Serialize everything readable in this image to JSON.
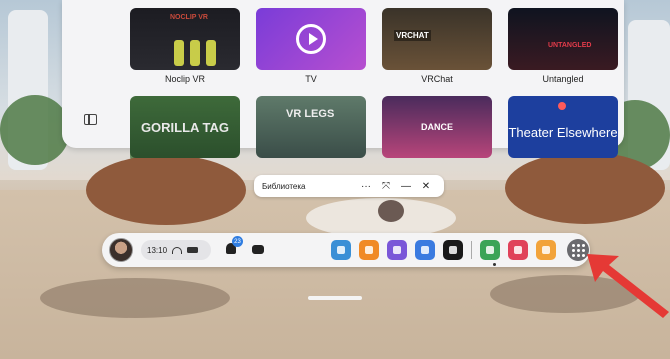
{
  "library": {
    "apps": [
      {
        "name": "Noclip VR",
        "thumb_text": "NOCLIP VR",
        "theme": "t-noclip"
      },
      {
        "name": "TV",
        "thumb_text": "",
        "theme": "t-tv"
      },
      {
        "name": "VRChat",
        "thumb_text": "VRCHAT",
        "theme": "t-vrchat"
      },
      {
        "name": "Untangled",
        "thumb_text": "UNTANGLED",
        "theme": "t-untangled"
      },
      {
        "name": "",
        "thumb_text": "GORILLA TAG",
        "theme": "t-gorilla"
      },
      {
        "name": "",
        "thumb_text": "VR LEGS",
        "theme": "t-vrlegs"
      },
      {
        "name": "",
        "thumb_text": "DANCE",
        "theme": "t-dance"
      },
      {
        "name": "",
        "thumb_text": "Theater Elsewhere",
        "theme": "t-theater"
      }
    ]
  },
  "titlebar": {
    "title": "Библиотека",
    "more_label": "···",
    "expand_label": "⤧",
    "minimize_label": "—",
    "close_label": "✕"
  },
  "dock": {
    "time": "13:10",
    "notification_count": "23",
    "app_icons": [
      {
        "name": "app-icon-photos",
        "color": "#3a8fd6"
      },
      {
        "name": "app-icon-store",
        "color": "#f08a26"
      },
      {
        "name": "app-icon-messenger",
        "color": "#7a57d8"
      },
      {
        "name": "app-icon-explore",
        "color": "#3b7be0"
      },
      {
        "name": "app-icon-theater-elsewhere",
        "color": "#1a1a1a"
      },
      {
        "name": "app-icon-files",
        "color": "#3aa457"
      },
      {
        "name": "app-icon-camera",
        "color": "#e0425a"
      },
      {
        "name": "app-icon-home",
        "color": "#f2a33a"
      }
    ],
    "apps_button_icon": "grid-icon"
  },
  "colors": {
    "accent_badge": "#2f7de1",
    "arrow": "#e53935"
  }
}
